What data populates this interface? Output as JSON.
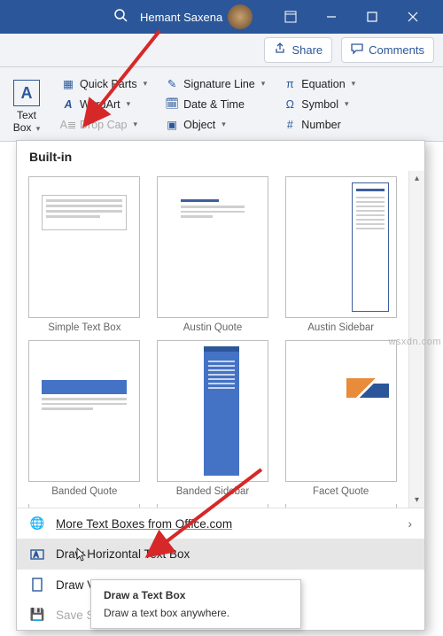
{
  "titlebar": {
    "user": "Hemant Saxena"
  },
  "actionbar": {
    "share": "Share",
    "comments": "Comments"
  },
  "ribbon": {
    "textbox_label1": "Text",
    "textbox_label2": "Box",
    "col1": {
      "quickparts": "Quick Parts",
      "wordart": "WordArt",
      "dropcap": "Drop Cap"
    },
    "col2": {
      "sig": "Signature Line",
      "date": "Date & Time",
      "object": "Object"
    },
    "col3": {
      "equation": "Equation",
      "symbol": "Symbol",
      "number": "Number"
    }
  },
  "panel": {
    "header": "Built-in",
    "thumbs": [
      {
        "name": "Simple Text Box"
      },
      {
        "name": "Austin Quote"
      },
      {
        "name": "Austin Sidebar"
      },
      {
        "name": "Banded Quote"
      },
      {
        "name": "Banded Sidebar"
      },
      {
        "name": "Facet Quote"
      }
    ],
    "menu": {
      "more": "More Text Boxes from Office.com",
      "draw_h": "Draw Horizontal Text Box",
      "draw_v": "Draw V",
      "save": "Save Se"
    }
  },
  "tooltip": {
    "title": "Draw a Text Box",
    "body": "Draw a text box anywhere."
  },
  "watermark": "wsxdn.com"
}
